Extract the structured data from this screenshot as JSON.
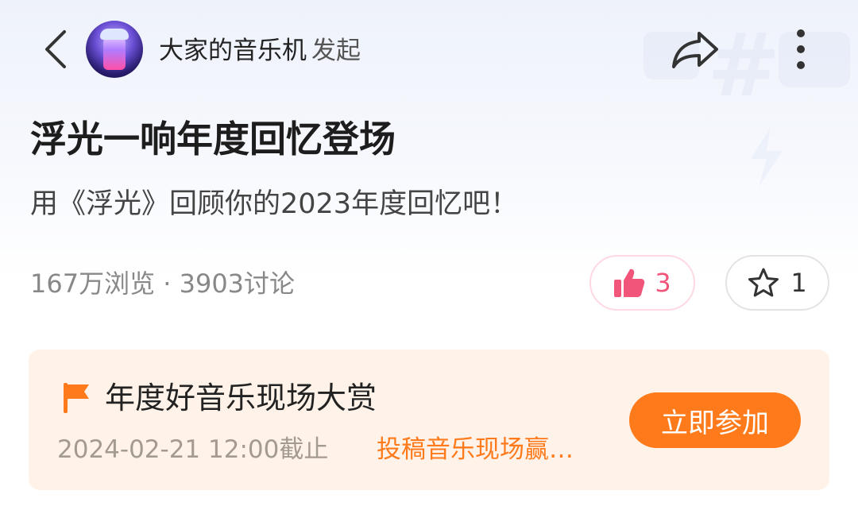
{
  "header": {
    "initiator_name": "大家的音乐机",
    "initiator_suffix": "发起",
    "icons": {
      "back": "back-chevron-icon",
      "share": "share-arrow-icon",
      "more": "more-vertical-icon"
    }
  },
  "topic": {
    "title": "浮光一响年度回忆登场",
    "subtitle": "用《浮光》回顾你的2023年度回忆吧！",
    "stats": "167万浏览 · 3903讨论"
  },
  "actions": {
    "like_count": "3",
    "favorite_count": "1",
    "like_color": "#f2557a"
  },
  "activity": {
    "title": "年度好音乐现场大赏",
    "deadline": "2024-02-21 12:00截止",
    "description": "投稿音乐现场赢…",
    "join_label": "立即参加",
    "accent_color": "#ff7a1a",
    "card_color": "#fff3e9"
  }
}
